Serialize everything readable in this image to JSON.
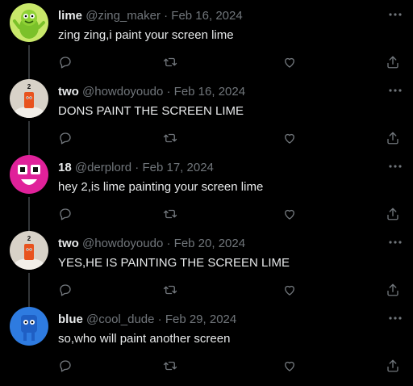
{
  "tweets": [
    {
      "name": "lime",
      "handle": "@zing_maker",
      "date": "Feb 16, 2024",
      "text": "zing zing,i paint your screen lime",
      "avatar": "lime-character"
    },
    {
      "name": "two",
      "handle": "@howdoyoudo",
      "date": "Feb 16, 2024",
      "text": "DONS PAINT THE SCREEN LIME",
      "avatar": "two-character"
    },
    {
      "name": "18",
      "handle": "@derplord",
      "date": "Feb 17, 2024",
      "text": "hey 2,is lime painting your screen lime",
      "avatar": "pink-face"
    },
    {
      "name": "two",
      "handle": "@howdoyoudo",
      "date": "Feb 20, 2024",
      "text": "YES,HE IS PAINTING THE SCREEN LIME",
      "avatar": "two-character"
    },
    {
      "name": "blue",
      "handle": "@cool_dude",
      "date": "Feb 29, 2024",
      "text": "so,who will paint another screen",
      "avatar": "blue-character"
    }
  ],
  "separator": "·",
  "icons": {
    "more": "more-icon",
    "reply": "reply-icon",
    "retweet": "retweet-icon",
    "like": "heart-icon",
    "share": "share-icon"
  },
  "colors": {
    "background": "#000000",
    "text": "#e7e9ea",
    "muted": "#71767b",
    "thread_line": "#333639"
  }
}
